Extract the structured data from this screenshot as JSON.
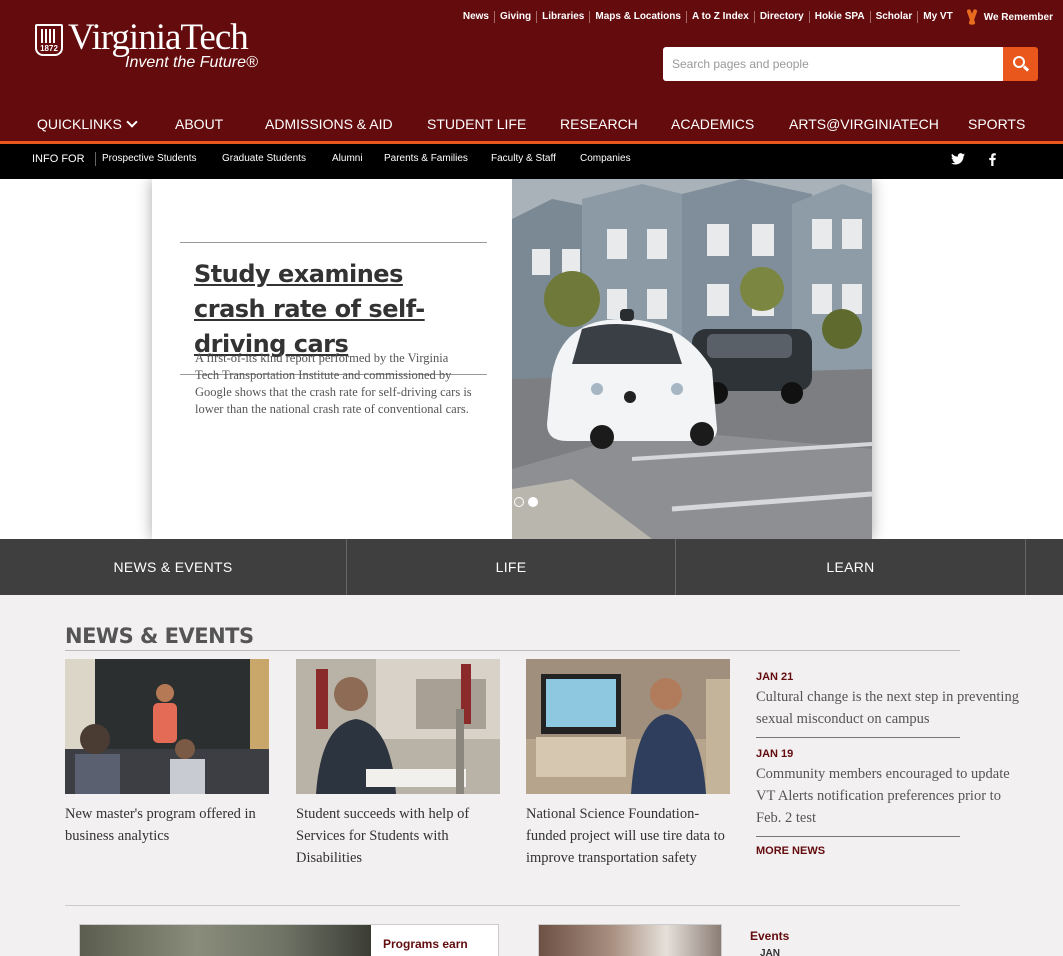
{
  "brand": {
    "wordmark": "VirginiaTech",
    "tagline": "Invent the Future",
    "year": "1872",
    "colors": {
      "maroon": "#630b0d",
      "orange": "#e9571d",
      "black": "#000000",
      "tabbar": "#3f3f3f"
    }
  },
  "utility_links": [
    "News",
    "Giving",
    "Libraries",
    "Maps & Locations",
    "A to Z Index",
    "Directory",
    "Hokie SPA",
    "Scholar",
    "My VT"
  ],
  "we_remember": "We Remember",
  "search": {
    "placeholder": "Search pages and people"
  },
  "main_nav": [
    "QUICKLINKS",
    "ABOUT",
    "ADMISSIONS & AID",
    "STUDENT LIFE",
    "RESEARCH",
    "ACADEMICS",
    "ARTS@VIRGINIATECH",
    "SPORTS"
  ],
  "info_for": {
    "label": "INFO FOR",
    "links": [
      "Prospective Students",
      "Graduate Students",
      "Alumni",
      "Parents & Families",
      "Faculty & Staff",
      "Companies"
    ]
  },
  "social": {
    "twitter": "twitter-icon",
    "facebook": "facebook-icon"
  },
  "hero": {
    "title": "Study examines crash rate of self-driving cars",
    "description": "A first-of-its kind report performed by the Virginia Tech Transportation Institute and commissioned by Google shows that the crash rate for self-driving cars is lower than the national crash rate of conventional cars.",
    "slides": 2,
    "active_slide": 2
  },
  "tabs": [
    "NEWS & EVENTS",
    "LIFE",
    "LEARN"
  ],
  "news": {
    "title": "NEWS & EVENTS",
    "cards": [
      {
        "caption": "New master's program offered in business analytics"
      },
      {
        "caption": "Student succeeds with help of Services for Students with Disabilities"
      },
      {
        "caption": "National Science Foundation-funded project will use tire data to improve transportation safety"
      }
    ],
    "side": [
      {
        "date": "JAN 21",
        "headline": "Cultural change is the next step in preventing sexual misconduct on campus"
      },
      {
        "date": "JAN 19",
        "headline": "Community members encouraged to update VT Alerts notification preferences prior to Feb. 2 test"
      }
    ],
    "more": "MORE NEWS"
  },
  "bottom": {
    "promo_text": "Programs earn",
    "events_label": "Events",
    "events_month": "JAN"
  }
}
